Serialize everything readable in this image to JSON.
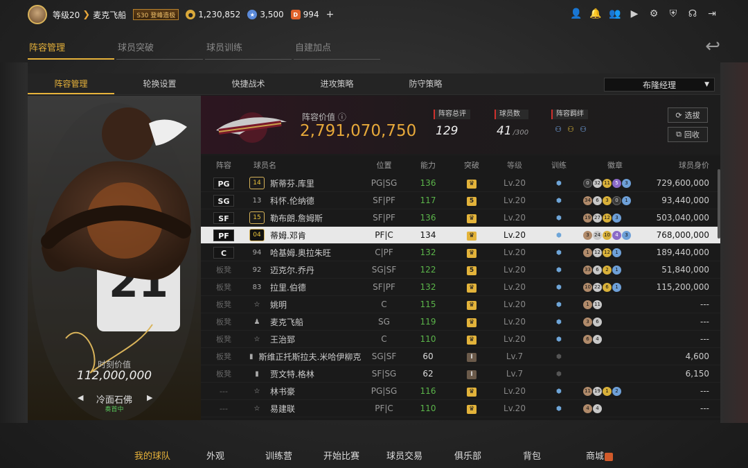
{
  "topbar": {
    "level": "等级20",
    "player_name": "麦克飞船",
    "season_badge": "S30 登峰造极",
    "coins": "1,230,852",
    "stars": "3,500",
    "diamonds": "994",
    "plus": "+"
  },
  "main_tabs": [
    {
      "label": "阵容管理"
    },
    {
      "label": "球员突破"
    },
    {
      "label": "球员训练"
    },
    {
      "label": "自建加点"
    }
  ],
  "sub_tabs": [
    {
      "label": "阵容管理"
    },
    {
      "label": "轮换设置"
    },
    {
      "label": "快捷战术"
    },
    {
      "label": "进攻策略"
    },
    {
      "label": "防守策略"
    }
  ],
  "manager_select": "布隆经理",
  "card": {
    "title": "时刻价值",
    "value": "112,000,000",
    "name": "冷面石佛",
    "status": "奏首中",
    "jersey_number": "21"
  },
  "summary": {
    "value_label": "阵容价值",
    "value": "2,791,070,750",
    "rating_label": "阵容总评",
    "rating": "129",
    "count_label": "球员数",
    "count": "41",
    "count_max": "/300",
    "bond_label": "阵容羁绊",
    "btn_scout": "选拔",
    "btn_recycle": "回收"
  },
  "table": {
    "headers": {
      "pos": "阵容",
      "name": "球员名",
      "fpos": "位置",
      "ability": "能力",
      "breakthrough": "突破",
      "level": "等级",
      "training": "训练",
      "badges": "徽章",
      "value": "球员身价"
    },
    "rows": [
      {
        "pos": "PG",
        "num": "14",
        "name": "斯蒂芬.库里",
        "fpos": "PG|SG",
        "ability": "136",
        "brk": "",
        "lv": "Lv.20",
        "badges": [
          {
            "t": "k",
            "v": "0"
          },
          {
            "t": "s",
            "v": "32"
          },
          {
            "t": "g",
            "v": "11"
          },
          {
            "t": "p",
            "v": "5"
          },
          {
            "t": "u",
            "v": "3"
          }
        ],
        "value": "729,600,000"
      },
      {
        "pos": "SG",
        "num": "13",
        "name": "科怀.伦纳德",
        "fpos": "SF|PF",
        "ability": "117",
        "brk": "5",
        "lv": "Lv.20",
        "badges": [
          {
            "t": "b",
            "v": "34"
          },
          {
            "t": "s",
            "v": "6"
          },
          {
            "t": "g",
            "v": "3"
          },
          {
            "t": "k",
            "v": "0"
          },
          {
            "t": "u",
            "v": "1"
          }
        ],
        "value": "93,440,000"
      },
      {
        "pos": "SF",
        "num": "15",
        "name": "勒布朗.詹姆斯",
        "fpos": "SF|PF",
        "ability": "136",
        "brk": "",
        "lv": "Lv.20",
        "badges": [
          {
            "t": "b",
            "v": "19"
          },
          {
            "t": "s",
            "v": "27"
          },
          {
            "t": "g",
            "v": "12"
          },
          {
            "t": "u",
            "v": "3"
          }
        ],
        "value": "503,040,000"
      },
      {
        "pos": "PF",
        "num": "04",
        "name": "蒂姆.邓肯",
        "fpos": "PF|C",
        "ability": "134",
        "brk": "",
        "lv": "Lv.20",
        "badges": [
          {
            "t": "b",
            "v": "3"
          },
          {
            "t": "s",
            "v": "24"
          },
          {
            "t": "g",
            "v": "10"
          },
          {
            "t": "p",
            "v": "4"
          },
          {
            "t": "u",
            "v": "3"
          }
        ],
        "value": "768,000,000"
      },
      {
        "pos": "C",
        "num": "94",
        "name": "哈基姆.奥拉朱旺",
        "fpos": "C|PF",
        "ability": "132",
        "brk": "",
        "lv": "Lv.20",
        "badges": [
          {
            "t": "b",
            "v": "1"
          },
          {
            "t": "s",
            "v": "12"
          },
          {
            "t": "g",
            "v": "12"
          },
          {
            "t": "u",
            "v": "1"
          }
        ],
        "value": "189,440,000"
      },
      {
        "pos": "板凳",
        "num": "92",
        "name": "迈克尔.乔丹",
        "fpos": "SG|SF",
        "ability": "122",
        "brk": "5",
        "lv": "Lv.20",
        "badges": [
          {
            "t": "b",
            "v": "33"
          },
          {
            "t": "s",
            "v": "6"
          },
          {
            "t": "g",
            "v": "2"
          },
          {
            "t": "u",
            "v": "1"
          }
        ],
        "value": "51,840,000"
      },
      {
        "pos": "板凳",
        "num": "83",
        "name": "拉里.伯德",
        "fpos": "SF|PF",
        "ability": "132",
        "brk": "",
        "lv": "Lv.20",
        "badges": [
          {
            "t": "b",
            "v": "10"
          },
          {
            "t": "s",
            "v": "22"
          },
          {
            "t": "g",
            "v": "6"
          },
          {
            "t": "u",
            "v": "1"
          }
        ],
        "value": "115,200,000"
      },
      {
        "pos": "板凳",
        "num": "☆",
        "name": "姚明",
        "fpos": "C",
        "ability": "115",
        "brk": "",
        "lv": "Lv.20",
        "badges": [
          {
            "t": "b",
            "v": "1"
          },
          {
            "t": "s",
            "v": "11"
          }
        ],
        "value": "---"
      },
      {
        "pos": "板凳",
        "num": "♟",
        "name": "麦克飞船",
        "fpos": "SG",
        "ability": "119",
        "brk": "",
        "lv": "Lv.20",
        "badges": [
          {
            "t": "b",
            "v": "3"
          },
          {
            "t": "s",
            "v": "6"
          }
        ],
        "value": "---"
      },
      {
        "pos": "板凳",
        "num": "☆",
        "name": "王治郅",
        "fpos": "C",
        "ability": "110",
        "brk": "",
        "lv": "Lv.20",
        "badges": [
          {
            "t": "b",
            "v": "6"
          },
          {
            "t": "s",
            "v": "4"
          }
        ],
        "value": "---"
      },
      {
        "pos": "板凳",
        "num": "▮",
        "name": "斯维正托斯拉夫.米哈伊柳克",
        "fpos": "SG|SF",
        "ability": "60",
        "brk": "I",
        "lv": "Lv.7",
        "badges": [],
        "value": "4,600"
      },
      {
        "pos": "板凳",
        "num": "▮",
        "name": "贾文特.格林",
        "fpos": "SF|SG",
        "ability": "62",
        "brk": "I",
        "lv": "Lv.7",
        "badges": [],
        "value": "6,150"
      },
      {
        "pos": "---",
        "num": "☆",
        "name": "林书豪",
        "fpos": "PG|SG",
        "ability": "116",
        "brk": "",
        "lv": "Lv.20",
        "badges": [
          {
            "t": "b",
            "v": "11"
          },
          {
            "t": "s",
            "v": "19"
          },
          {
            "t": "g",
            "v": "1"
          },
          {
            "t": "u",
            "v": "2"
          }
        ],
        "value": "---"
      },
      {
        "pos": "---",
        "num": "☆",
        "name": "易建联",
        "fpos": "PF|C",
        "ability": "110",
        "brk": "",
        "lv": "Lv.20",
        "badges": [
          {
            "t": "b",
            "v": "4"
          },
          {
            "t": "s",
            "v": "4"
          }
        ],
        "value": "---"
      }
    ]
  },
  "bottom_nav": [
    {
      "label": "我的球队"
    },
    {
      "label": "外观"
    },
    {
      "label": "训练营"
    },
    {
      "label": "开始比赛"
    },
    {
      "label": "球员交易"
    },
    {
      "label": "俱乐部"
    },
    {
      "label": "背包"
    },
    {
      "label": "商城"
    }
  ],
  "colors": {
    "accent": "#e7b23a",
    "green": "#5bb54a",
    "red": "#d0312d"
  }
}
